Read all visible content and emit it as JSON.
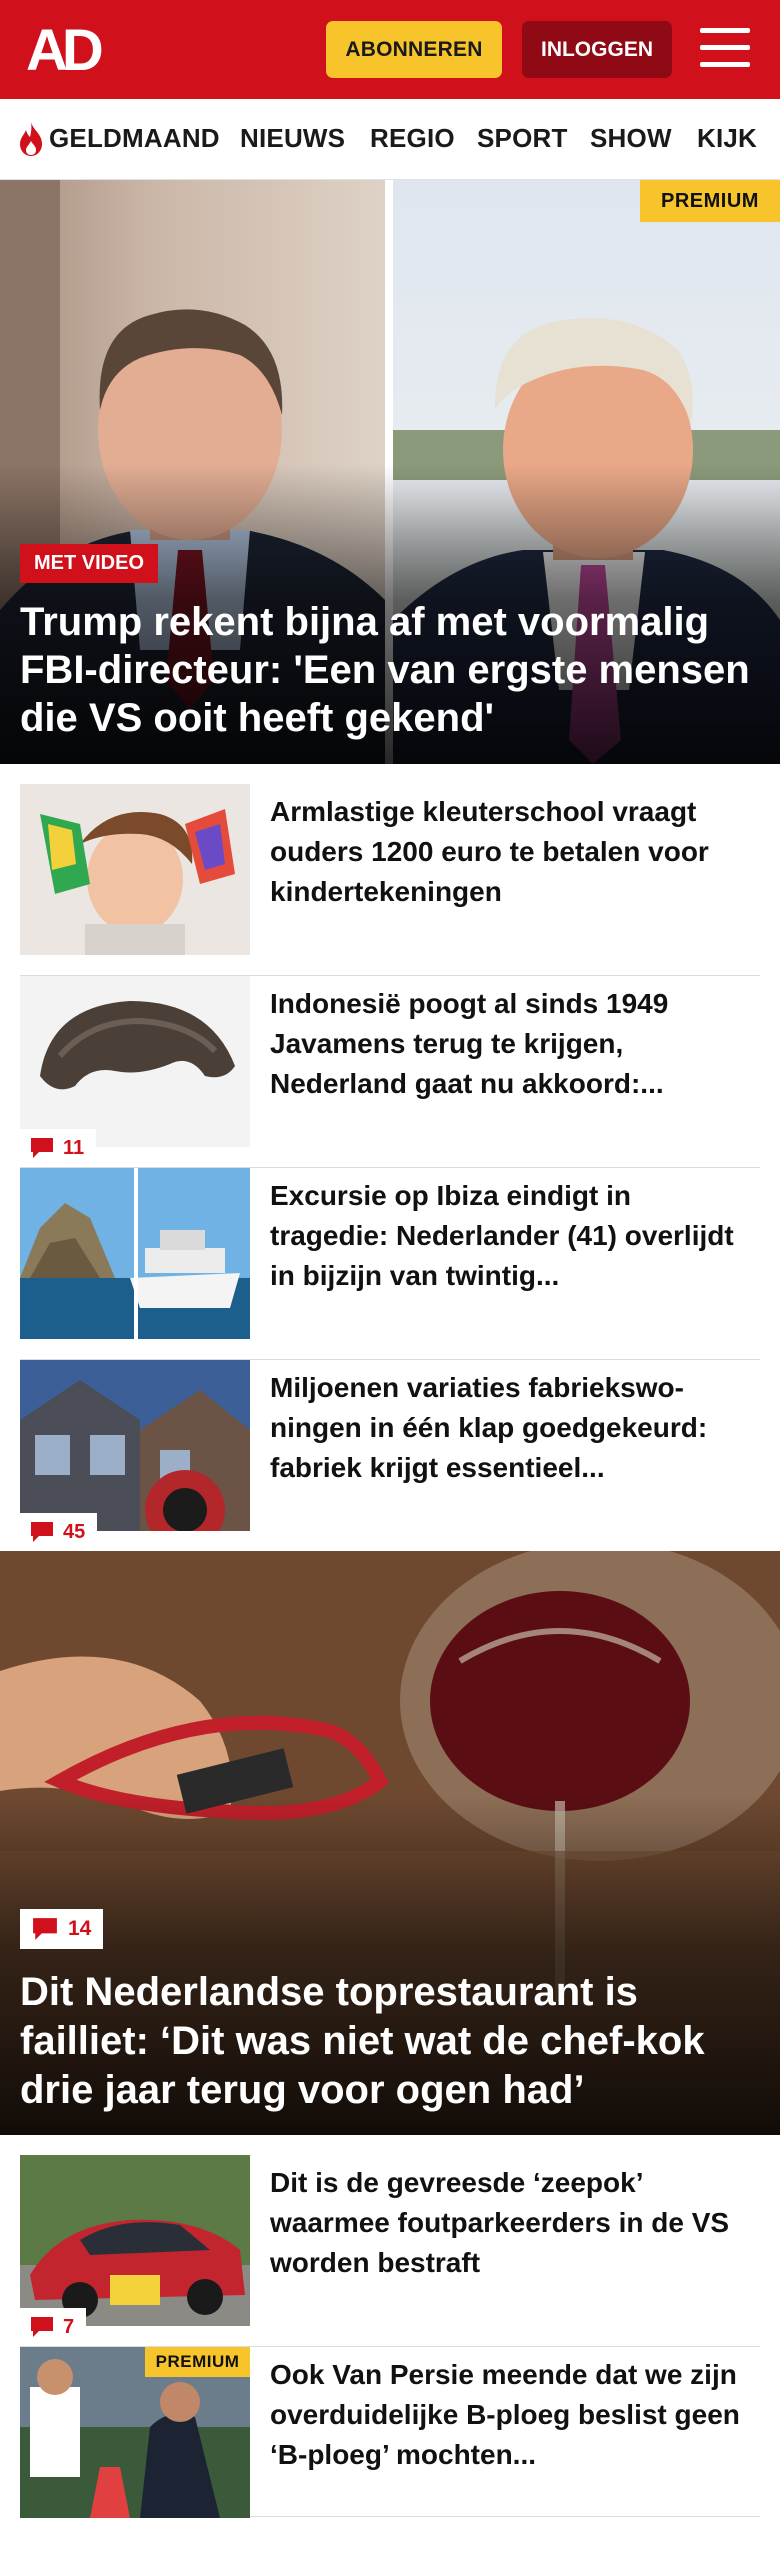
{
  "header": {
    "logo_text": "AD",
    "subscribe_label": "ABONNEREN",
    "login_label": "INLOGGEN",
    "colors": {
      "brand_red": "#d0101b",
      "accent_yellow": "#f7c52b",
      "login_dark": "#8f0a14"
    }
  },
  "nav": {
    "items": [
      {
        "label": "GELDMAAND",
        "icon": "flame-icon"
      },
      {
        "label": "NIEUWS"
      },
      {
        "label": "REGIO"
      },
      {
        "label": "SPORT"
      },
      {
        "label": "SHOW"
      },
      {
        "label": "KIJK"
      }
    ]
  },
  "hero": {
    "premium_label": "PREMIUM",
    "tag": "MET VIDEO",
    "title": "Trump rekent bijna af met voormalig FBI-directeur: 'Een van ergste mensen die VS ooit heeft gekend'"
  },
  "articles": [
    {
      "title": "Armlastige kleuterschool vraagt ouders 1200 euro te betalen voor kindertekeningen",
      "comments": ""
    },
    {
      "title": "Indonesië poogt al sinds 1949 Javamens terug te krijgen, Nederland gaat nu akkoord:...",
      "comments": "11"
    },
    {
      "title": "Excursie op Ibiza eindigt in tragedie: Nederlander (41) overlijdt in bijzijn van twintig...",
      "comments": ""
    },
    {
      "title": "Miljoenen variaties fabriekswo­ningen in één klap goedgekeurd: fabriek krijgt essentieel...",
      "comments": "45"
    }
  ],
  "feature": {
    "comments": "14",
    "title": "Dit Nederlandse toprestaurant is failliet: ‘Dit was niet wat de chef-kok drie jaar terug voor ogen had’"
  },
  "articles2": [
    {
      "title": "Dit is de gevreesde ‘zeepok’ waarmee foutparkeerders in de VS worden bestraft",
      "comments": "7"
    },
    {
      "title": "Ook Van Persie meende dat we zijn overduidelijke B-ploeg beslist geen ‘B-ploeg’ mochten...",
      "premium_label": "PREMIUM"
    }
  ]
}
